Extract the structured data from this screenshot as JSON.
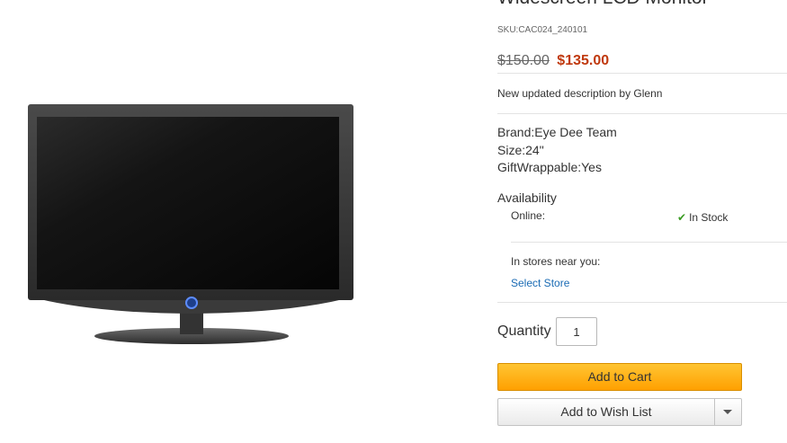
{
  "product": {
    "title": "Widescreen LCD Monitor",
    "sku": "SKU:CAC024_240101",
    "price": {
      "old": "$150.00",
      "sale": "$135.00"
    },
    "description": "New updated description by Glenn",
    "attributes": [
      "Brand:Eye Dee Team",
      "Size:24\"",
      "GiftWrappable:Yes"
    ]
  },
  "availability": {
    "heading": "Availability",
    "online_label": "Online:",
    "online_status": "In Stock",
    "stores_label": "In stores near you:",
    "select_store": "Select Store"
  },
  "purchase": {
    "quantity_label": "Quantity",
    "quantity_value": "1",
    "add_to_cart": "Add to Cart",
    "add_to_wish_list": "Add to Wish List"
  },
  "colors": {
    "sale_price": "#c0390e",
    "link": "#1a6bb4",
    "cart_button": "#ffa000",
    "in_stock_check": "#3a9b23"
  },
  "icons": {
    "in_stock": "check-icon",
    "wish_list_menu": "caret-down-icon"
  }
}
